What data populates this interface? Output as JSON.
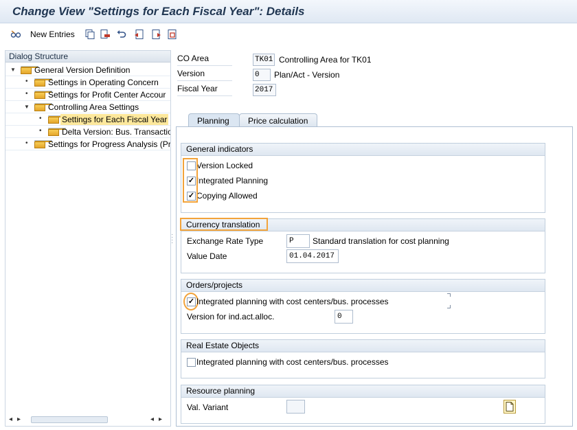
{
  "window": {
    "title": "Change View \"Settings for Each Fiscal Year\": Details"
  },
  "toolbar": {
    "new_entries_label": "New Entries",
    "icons": [
      "edit-glasses-icon",
      "copy-icon",
      "delete-icon",
      "undo-icon",
      "previous-entry-icon",
      "next-entry-icon",
      "select-all-icon"
    ]
  },
  "dialog_structure": {
    "title": "Dialog Structure",
    "items": [
      {
        "label": "General Version Definition",
        "level": 0,
        "expanded": true
      },
      {
        "label": "Settings in Operating Concern",
        "level": 1
      },
      {
        "label": "Settings for Profit Center Accour",
        "level": 1
      },
      {
        "label": "Controlling Area Settings",
        "level": 1,
        "expanded": true
      },
      {
        "label": "Settings for Each Fiscal Year",
        "level": 2,
        "selected": true
      },
      {
        "label": "Delta Version: Bus. Transactio",
        "level": 2
      },
      {
        "label": "Settings for Progress Analysis (Pr",
        "level": 1
      }
    ]
  },
  "header": {
    "co_area": {
      "label": "CO Area",
      "value": "TK01",
      "description": "Controlling Area for TK01"
    },
    "version": {
      "label": "Version",
      "value": "0",
      "description": "Plan/Act - Version"
    },
    "fiscal_year": {
      "label": "Fiscal Year",
      "value": "2017"
    }
  },
  "tabs": [
    {
      "label": "Planning",
      "active": true
    },
    {
      "label": "Price calculation",
      "active": false
    }
  ],
  "general_indicators": {
    "title": "General indicators",
    "version_locked": {
      "label": "Version Locked",
      "checked": false
    },
    "integrated_planning": {
      "label": "Integrated Planning",
      "checked": true
    },
    "copying_allowed": {
      "label": "Copying Allowed",
      "checked": true
    }
  },
  "currency_translation": {
    "title": "Currency translation",
    "exchange_rate_type": {
      "label": "Exchange Rate Type",
      "value": "P",
      "description": "Standard translation for cost planning"
    },
    "value_date": {
      "label": "Value Date",
      "value": "01.04.2017"
    }
  },
  "orders_projects": {
    "title": "Orders/projects",
    "integrated_planning": {
      "label": "Integrated planning with cost centers/bus. processes",
      "checked": true
    },
    "version_ind_act_alloc": {
      "label": "Version for ind.act.alloc.",
      "value": "0"
    }
  },
  "real_estate": {
    "title": "Real Estate Objects",
    "integrated_planning": {
      "label": "Integrated planning with cost centers/bus. processes",
      "checked": false
    }
  },
  "resource_planning": {
    "title": "Resource planning",
    "val_variant": {
      "label": "Val. Variant",
      "value": ""
    }
  },
  "colors": {
    "highlight": "#f2a33a",
    "selected_row": "#fde89c",
    "folder": "#f0bb3e",
    "title_text": "#1f3551"
  }
}
